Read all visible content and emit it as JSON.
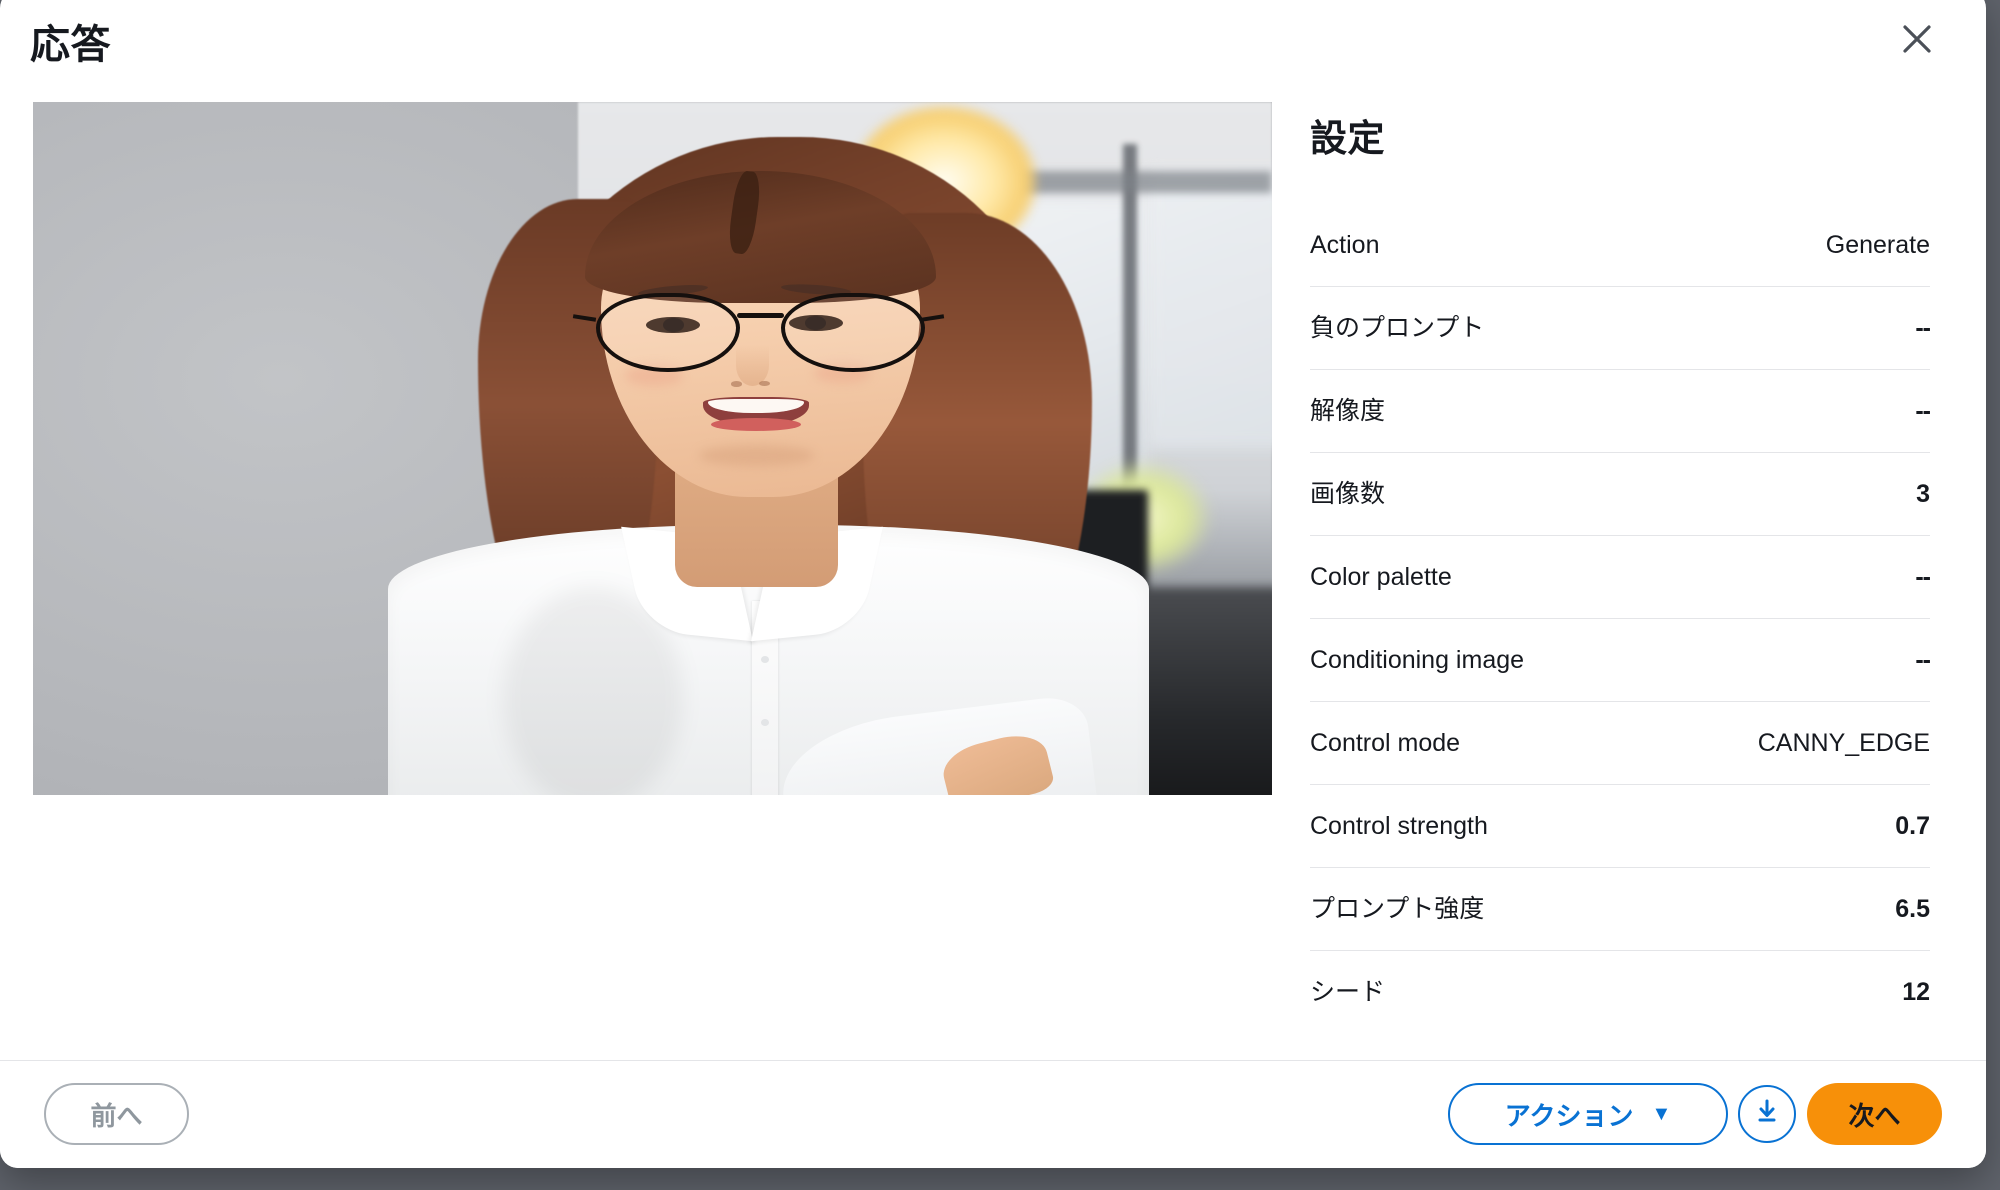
{
  "modal": {
    "title": "応答",
    "close_icon": "close-icon"
  },
  "settings": {
    "heading": "設定",
    "rows": [
      {
        "key": "Action",
        "value": "Generate"
      },
      {
        "key": "負のプロンプト",
        "value": "--"
      },
      {
        "key": "解像度",
        "value": "--"
      },
      {
        "key": "画像数",
        "value": "3"
      },
      {
        "key": "Color palette",
        "value": "--"
      },
      {
        "key": "Conditioning image",
        "value": "--"
      },
      {
        "key": "Control mode",
        "value": "CANNY_EDGE"
      },
      {
        "key": "Control strength",
        "value": "0.7"
      },
      {
        "key": "プロンプト強度",
        "value": "6.5"
      },
      {
        "key": "シード",
        "value": "12"
      }
    ]
  },
  "image": {
    "alt": "生成された画像: 眼鏡をかけて腕を組み微笑むオフィスの女性",
    "background_color": "#b3b5b8"
  },
  "footer": {
    "prev_label": "前へ",
    "action_label": "アクション",
    "action_caret": "▼",
    "download_icon": "download-icon",
    "next_label": "次へ"
  },
  "colors": {
    "accent_blue": "#0972d3",
    "accent_orange": "#f79009",
    "text_primary": "#16191f",
    "divider": "#e4e5e8",
    "backdrop": "#5f636b"
  }
}
